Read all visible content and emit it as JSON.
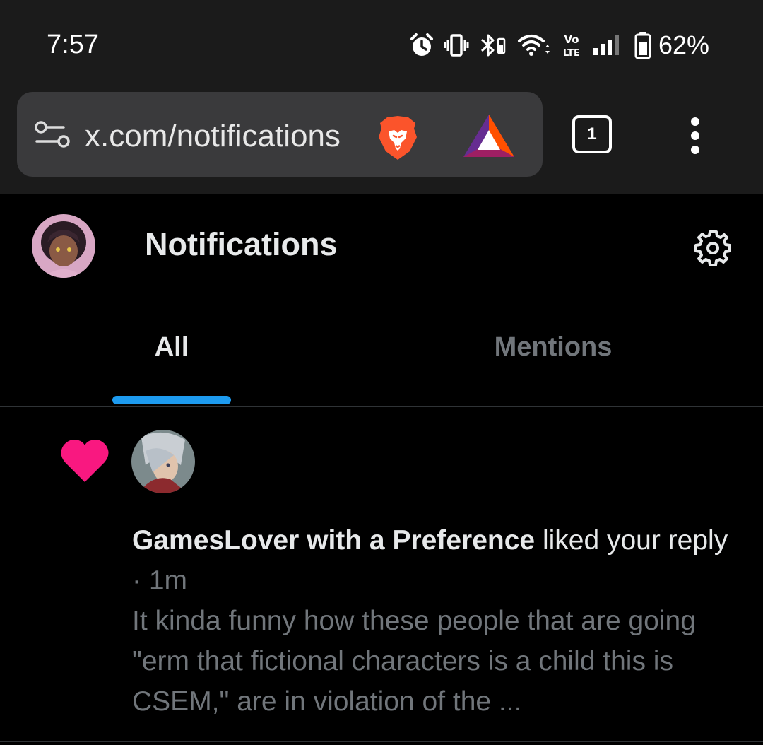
{
  "status_bar": {
    "time": "7:57",
    "battery_percent": "62%",
    "icons": [
      "alarm-icon",
      "vibrate-icon",
      "bluetooth-icon",
      "wifi-icon",
      "volte-icon",
      "signal-icon",
      "battery-icon"
    ],
    "volte_label_top": "Vo",
    "volte_label_bottom": "LTE"
  },
  "browser": {
    "url": "x.com/notifications",
    "tab_count": "1",
    "icons": [
      "site-settings-icon",
      "brave-shields-icon",
      "bat-rewards-icon",
      "tab-switcher-icon",
      "more-menu-icon"
    ]
  },
  "header": {
    "title": "Notifications",
    "icons": [
      "avatar",
      "settings-icon"
    ]
  },
  "tabs": [
    {
      "label": "All",
      "active": true
    },
    {
      "label": "Mentions",
      "active": false
    }
  ],
  "colors": {
    "accent": "#1d9bf0",
    "like": "#f91880",
    "background": "#000000",
    "muted_text": "#71767b",
    "brave_orange": "#fb542b"
  },
  "notifications": [
    {
      "type": "like",
      "icon": "heart-icon",
      "user_name": "GamesLover with a Preference",
      "action": "liked your reply",
      "separator": "·",
      "time": "1m",
      "preview": "It kinda funny how these people that are going \"erm that fictional characters is a child this is CSEM,\" are in violation of the ..."
    }
  ]
}
